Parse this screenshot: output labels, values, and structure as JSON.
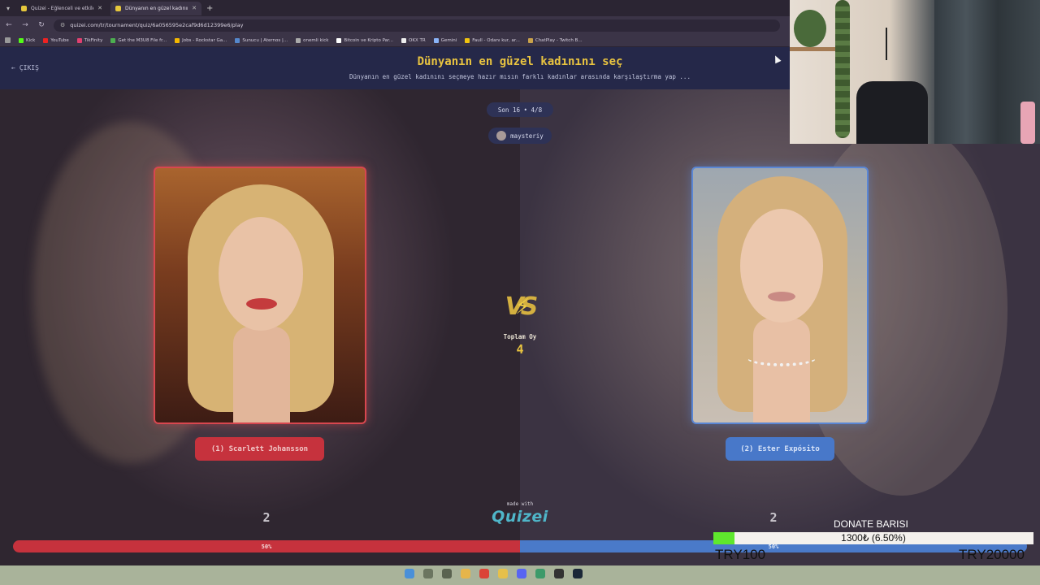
{
  "browser": {
    "tabs": [
      {
        "title": "Quizei - Eğlenceli ve etkileşimli...",
        "active": false
      },
      {
        "title": "Dünyanın en güzel kadınını seç...",
        "active": true
      }
    ],
    "new_tab": "+",
    "url": "quizei.com/tr/tournament/quiz/6a056595e2caf9d6d12399e6/play",
    "bookmarks": [
      "Kick",
      "YouTube",
      "TikFinity",
      "Get the M3U8 File fr...",
      "Jobs - Rockstar Ga...",
      "Sunucu | Aternos |...",
      "onemli kick",
      "Bitcoin ve Kripto Par...",
      "OKX TR",
      "Gemini",
      "Faull - Odanı kur, ar...",
      "ChatPlay - Twitch B..."
    ]
  },
  "header": {
    "exit_label": "ÇIKIŞ",
    "title": "Dünyanın en güzel kadınını seç",
    "subtitle": "Dünyanın en güzel kadınını seçmeye hazır mısın farklı kadınlar arasında karşılaştırma yap ..."
  },
  "round": {
    "label": "Son 16 • 4/8",
    "username": "maysteriy"
  },
  "contestants": {
    "left": {
      "label": "(1) Scarlett Johansson",
      "votes": "2",
      "percent_label": "50%",
      "percent": 50,
      "color": "#c6323d"
    },
    "right": {
      "label": "(2) Ester Expósito",
      "votes": "2",
      "percent_label": "50%",
      "percent": 50,
      "color": "#4a7ac9"
    }
  },
  "center": {
    "total_label": "Toplam Oy",
    "total_value": "4"
  },
  "footer": {
    "made_with": "made with",
    "brand": "Quizei"
  },
  "donate": {
    "title": "DONATE BARISI",
    "progress_text": "1300₺ (6.50%)",
    "progress_fraction": 0.065,
    "min_label": "TRY100",
    "max_label": "TRY20000",
    "fill_color": "#5fe82d"
  },
  "accent": {
    "gold": "#e9c440",
    "red": "#c6323d",
    "blue": "#4a7ac9",
    "header_bg": "#252849"
  }
}
